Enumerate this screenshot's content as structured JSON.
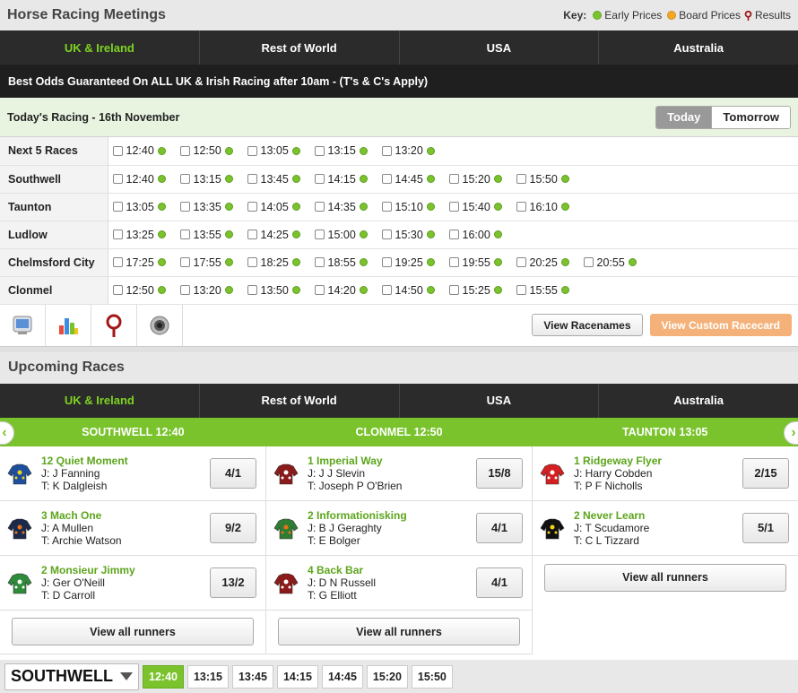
{
  "header": {
    "title": "Horse Racing Meetings",
    "key_label": "Key:",
    "key": [
      {
        "label": "Early Prices",
        "color": "#7ac32d"
      },
      {
        "label": "Board Prices",
        "color": "#f5a623"
      },
      {
        "label": "Results",
        "color": "#a01818"
      }
    ]
  },
  "region_tabs": [
    "UK & Ireland",
    "Rest of World",
    "USA",
    "Australia"
  ],
  "promo": "Best Odds Guaranteed On ALL UK & Irish Racing after 10am - (T's & C's Apply)",
  "racing_day": {
    "title": "Today's Racing - 16th November",
    "today": "Today",
    "tomorrow": "Tomorrow"
  },
  "meetings": [
    {
      "name": "Next 5 Races",
      "times": [
        "12:40",
        "12:50",
        "13:05",
        "13:15",
        "13:20"
      ]
    },
    {
      "name": "Southwell",
      "times": [
        "12:40",
        "13:15",
        "13:45",
        "14:15",
        "14:45",
        "15:20",
        "15:50"
      ]
    },
    {
      "name": "Taunton",
      "times": [
        "13:05",
        "13:35",
        "14:05",
        "14:35",
        "15:10",
        "15:40",
        "16:10"
      ]
    },
    {
      "name": "Ludlow",
      "times": [
        "13:25",
        "13:55",
        "14:25",
        "15:00",
        "15:30",
        "16:00"
      ]
    },
    {
      "name": "Chelmsford City",
      "times": [
        "17:25",
        "17:55",
        "18:25",
        "18:55",
        "19:25",
        "19:55",
        "20:25",
        "20:55"
      ]
    },
    {
      "name": "Clonmel",
      "times": [
        "12:50",
        "13:20",
        "13:50",
        "14:20",
        "14:50",
        "15:25",
        "15:55"
      ]
    }
  ],
  "tools": [
    "monitor-icon",
    "stats-icon",
    "results-pin-icon",
    "webcam-icon"
  ],
  "buttons": {
    "view_racenames": "View Racenames",
    "view_custom": "View Custom Racecard"
  },
  "upcoming": {
    "title": "Upcoming Races",
    "tabs": [
      "UK & Ireland",
      "Rest of World",
      "USA",
      "Australia"
    ],
    "view_all": "View all runners",
    "races": [
      {
        "title": "SOUTHWELL 12:40",
        "runners": [
          {
            "name": "12 Quiet Moment",
            "jockey": "J: J Fanning",
            "trainer": "T: K Dalgleish",
            "odds": "4/1",
            "silk": [
              "#1d4f9c",
              "#f2d21b"
            ]
          },
          {
            "name": "3 Mach One",
            "jockey": "J: A Mullen",
            "trainer": "T: Archie Watson",
            "odds": "9/2",
            "silk": [
              "#1b2a4a",
              "#e8731c"
            ]
          },
          {
            "name": "2 Monsieur Jimmy",
            "jockey": "J: Ger O'Neill",
            "trainer": "T: D Carroll",
            "odds": "13/2",
            "silk": [
              "#2e8b3a",
              "#ffffff"
            ]
          }
        ]
      },
      {
        "title": "CLONMEL 12:50",
        "runners": [
          {
            "name": "1 Imperial Way",
            "jockey": "J: J J Slevin",
            "trainer": "T: Joseph P O'Brien",
            "odds": "15/8",
            "silk": [
              "#8b1a1a",
              "#ffffff"
            ]
          },
          {
            "name": "2 Informationisking",
            "jockey": "J: B J Geraghty",
            "trainer": "T: E Bolger",
            "odds": "4/1",
            "silk": [
              "#2f7d32",
              "#e8731c"
            ]
          },
          {
            "name": "4 Back Bar",
            "jockey": "J: D N Russell",
            "trainer": "T: G Elliott",
            "odds": "4/1",
            "silk": [
              "#8b1a1a",
              "#ffffff"
            ]
          }
        ]
      },
      {
        "title": "TAUNTON 13:05",
        "runners": [
          {
            "name": "1 Ridgeway Flyer",
            "jockey": "J: Harry Cobden",
            "trainer": "T: P F Nicholls",
            "odds": "2/15",
            "silk": [
              "#d42020",
              "#ffffff"
            ]
          },
          {
            "name": "2 Never Learn",
            "jockey": "J: T Scudamore",
            "trainer": "T: C L Tizzard",
            "odds": "5/1",
            "silk": [
              "#111111",
              "#f2d21b"
            ]
          }
        ]
      }
    ]
  },
  "bottom": {
    "course": "SOUTHWELL",
    "times": [
      "12:40",
      "13:15",
      "13:45",
      "14:15",
      "14:45",
      "15:20",
      "15:50"
    ]
  }
}
